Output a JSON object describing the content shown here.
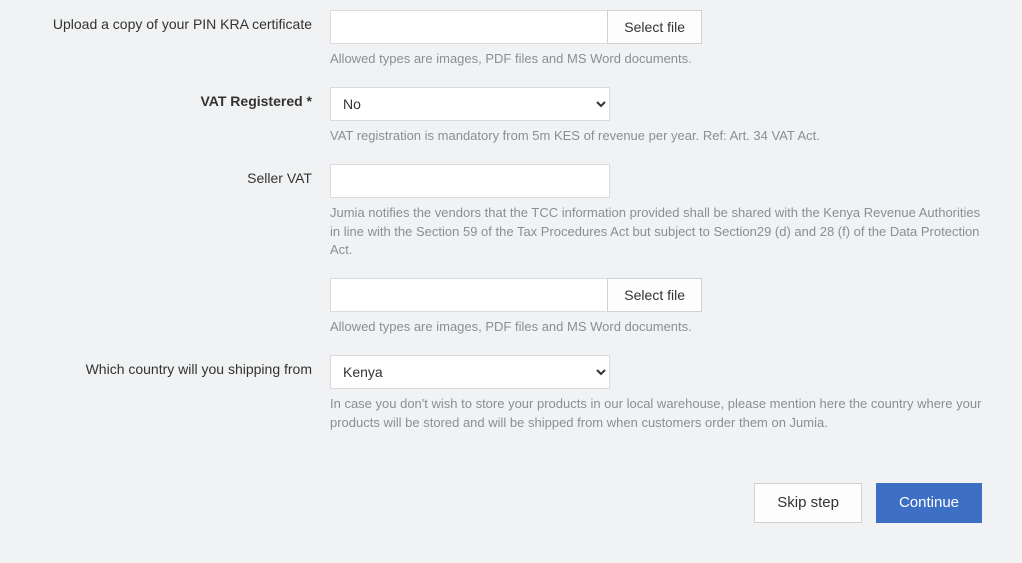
{
  "fields": {
    "pin_cert": {
      "label": "Upload a copy of your PIN KRA certificate",
      "button": "Select file",
      "hint": "Allowed types are images, PDF files and MS Word documents."
    },
    "vat_registered": {
      "label": "VAT Registered *",
      "value": "No",
      "hint": "VAT registration is mandatory from 5m KES of revenue per year. Ref: Art. 34 VAT Act."
    },
    "seller_vat": {
      "label": "Seller VAT",
      "value": "",
      "hint": "Jumia notifies the vendors that the TCC information provided shall be shared with the Kenya Revenue Authorities in line with the Section 59 of the Tax Procedures Act but subject to Section29 (d) and 28 (f) of the Data Protection Act."
    },
    "seller_vat_upload": {
      "button": "Select file",
      "hint": "Allowed types are images, PDF files and MS Word documents."
    },
    "ship_country": {
      "label": "Which country will you shipping from",
      "value": "Kenya",
      "hint": "In case you don't wish to store your products in our local warehouse, please mention here the country where your products will be stored and will be shipped from when customers order them on Jumia."
    }
  },
  "actions": {
    "skip": "Skip step",
    "continue": "Continue"
  }
}
